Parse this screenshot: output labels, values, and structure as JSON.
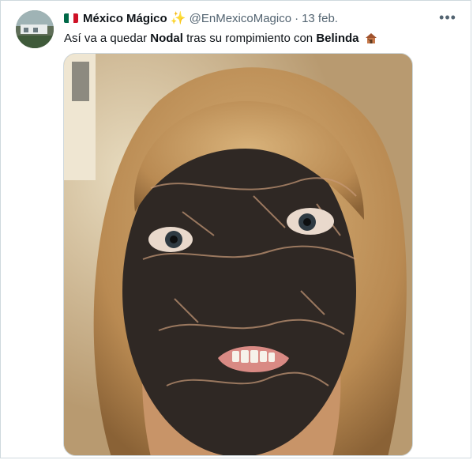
{
  "tweet": {
    "display_name": "México Mágico",
    "handle": "@EnMexicoMagico",
    "separator": "·",
    "date": "13 feb.",
    "text_parts": [
      "Así va a quedar ",
      "Nodal",
      " tras su rompimiento con ",
      "Belinda"
    ]
  },
  "icons": {
    "flag": "mexico-flag-icon",
    "sparkle": "sparkles-icon",
    "more": "more-options-icon",
    "house": "derelict-house-icon"
  },
  "colors": {
    "flag_green": "#006847",
    "flag_white": "#ffffff",
    "flag_red": "#ce1126",
    "text_secondary": "#536471",
    "border": "#cfd9de"
  }
}
